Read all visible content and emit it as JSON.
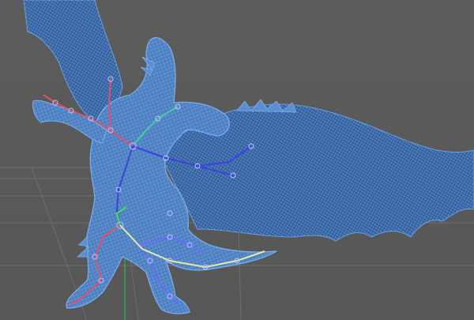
{
  "viewport": {
    "background": "#5a5a5a",
    "grid_color": "#6e6e6e",
    "mesh_color": "#5b8fd0",
    "mesh_line_color": "#2e4f80",
    "axis_y_color": "#2fa84a"
  },
  "model": {
    "name_icon": "dragon-mesh-icon",
    "rig": {
      "spine_color": "#4040e0",
      "left_arm_color": "#e0506a",
      "right_arm_color": "#3fd0a0",
      "tail_color": "#e8e8a0",
      "leg_color": "#6a6aff",
      "hip_color": "#40e060",
      "root_color": "#c040d0"
    }
  }
}
